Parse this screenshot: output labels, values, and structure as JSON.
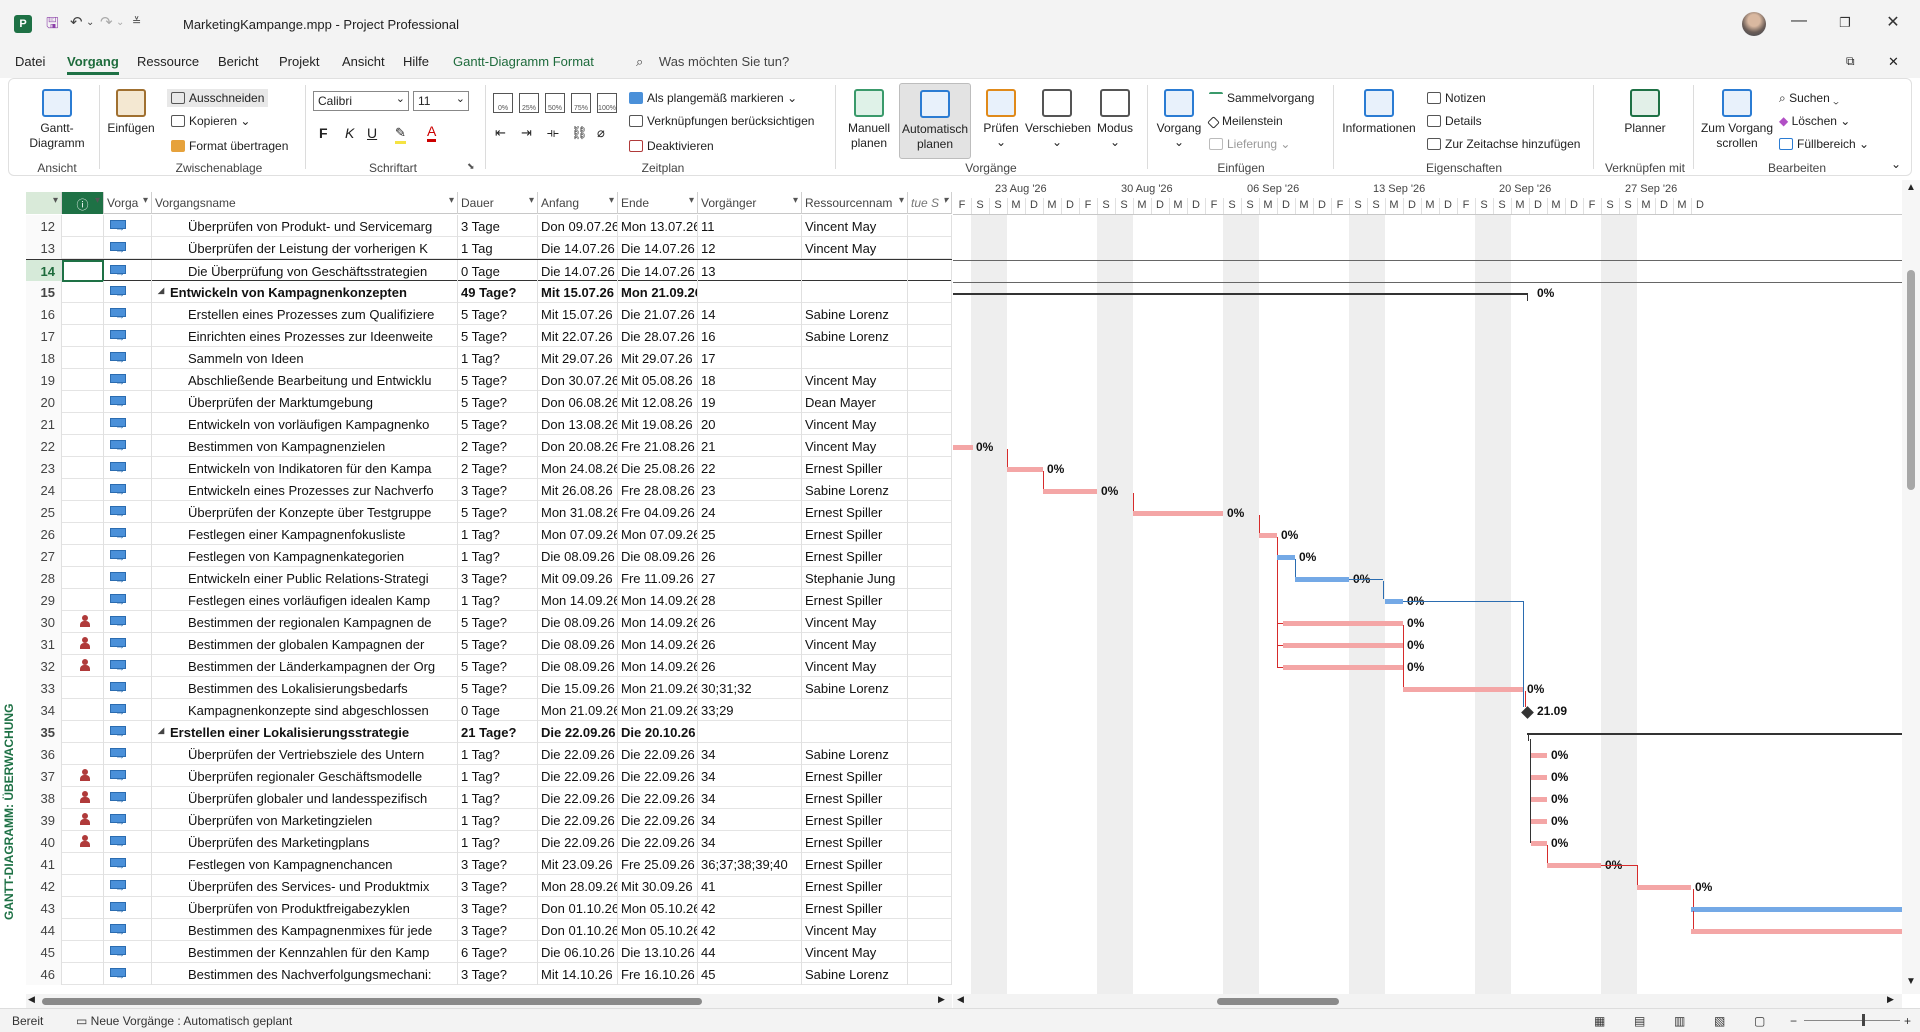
{
  "titlebar": {
    "title": "MarketingKampange.mpp  -  Project Professional",
    "app_icon_letter": "P"
  },
  "menu": {
    "tabs": [
      "Datei",
      "Vorgang",
      "Ressource",
      "Bericht",
      "Projekt",
      "Ansicht",
      "Hilfe",
      "Gantt-Diagramm Format"
    ],
    "active": "Vorgang",
    "search_placeholder": "Was möchten Sie tun?"
  },
  "ribbon": {
    "ansicht": {
      "button": "Gantt-Diagramm",
      "group": "Ansicht"
    },
    "zwischenablage": {
      "paste": "Einfügen",
      "cut": "Ausschneiden",
      "copy": "Kopieren",
      "format_painter": "Format übertragen",
      "group": "Zwischenablage"
    },
    "schriftart": {
      "font": "Calibri",
      "size": "11",
      "bold": "F",
      "italic": "K",
      "underline": "U",
      "group": "Schriftart"
    },
    "zeitplan": {
      "mark_on_track": "Als plangemäß markieren",
      "respect_links": "Verknüpfungen berücksichtigen",
      "deactivate": "Deaktivieren",
      "group": "Zeitplan",
      "pct": [
        "0%",
        "25%",
        "50%",
        "75%",
        "100%"
      ]
    },
    "vorgaenge": {
      "manual": "Manuell planen",
      "auto": "Automatisch planen",
      "inspect": "Prüfen",
      "move": "Verschieben",
      "mode": "Modus",
      "group": "Vorgänge"
    },
    "einfuegen": {
      "task": "Vorgang",
      "summary": "Sammelvorgang",
      "milestone": "Meilenstein",
      "deliverable": "Lieferung",
      "group": "Einfügen"
    },
    "eigenschaften": {
      "info": "Informationen",
      "notes": "Notizen",
      "details": "Details",
      "timeline": "Zur Zeitachse hinzufügen",
      "group": "Eigenschaften"
    },
    "verknuepfen": {
      "planner": "Planner",
      "group": "Verknüpfen mit"
    },
    "bearbeiten": {
      "scroll": "Zum Vorgang scrollen",
      "find": "Suchen",
      "clear": "Löschen",
      "fill": "Füllbereich",
      "group": "Bearbeiten"
    }
  },
  "sidebar": {
    "label": "GANTT-DIAGRAMM: ÜBERWACHUNG"
  },
  "table": {
    "headers": [
      "Vorga",
      "Vorgangsname",
      "Dauer",
      "Anfang",
      "Ende",
      "Vorgänger",
      "Ressourcennam",
      "tue S"
    ],
    "rows": [
      {
        "id": "12",
        "name": "Überprüfen von Produkt- und Servicemarg",
        "dur": "3 Tage",
        "start": "Don 09.07.26",
        "end": "Mon 13.07.26",
        "pred": "11",
        "res": "Vincent May",
        "indent": 2,
        "summary": false,
        "resicon": false
      },
      {
        "id": "13",
        "name": "Überprüfen der Leistung der vorherigen K",
        "dur": "1 Tag",
        "start": "Die 14.07.26",
        "end": "Die 14.07.26",
        "pred": "12",
        "res": "Vincent May",
        "indent": 2,
        "summary": false,
        "resicon": false
      },
      {
        "id": "14",
        "name": "Die Überprüfung von Geschäftsstrategien",
        "dur": "0 Tage",
        "start": "Die 14.07.26",
        "end": "Die 14.07.26",
        "pred": "13",
        "res": "",
        "indent": 2,
        "summary": false,
        "resicon": false,
        "selected": true
      },
      {
        "id": "15",
        "name": "Entwickeln von Kampagnenkonzepten",
        "dur": "49 Tage?",
        "start": "Mit 15.07.26",
        "end": "Mon 21.09.26",
        "pred": "",
        "res": "",
        "indent": 1,
        "summary": true,
        "resicon": false
      },
      {
        "id": "16",
        "name": "Erstellen eines Prozesses zum Qualifiziere",
        "dur": "5 Tage?",
        "start": "Mit 15.07.26",
        "end": "Die 21.07.26",
        "pred": "14",
        "res": "Sabine Lorenz",
        "indent": 2,
        "summary": false,
        "resicon": false
      },
      {
        "id": "17",
        "name": "Einrichten eines Prozesses zur Ideenweite",
        "dur": "5 Tage?",
        "start": "Mit 22.07.26",
        "end": "Die 28.07.26",
        "pred": "16",
        "res": "Sabine Lorenz",
        "indent": 2,
        "summary": false,
        "resicon": false
      },
      {
        "id": "18",
        "name": "Sammeln von Ideen",
        "dur": "1 Tag?",
        "start": "Mit 29.07.26",
        "end": "Mit 29.07.26",
        "pred": "17",
        "res": "",
        "indent": 2,
        "summary": false,
        "resicon": false
      },
      {
        "id": "19",
        "name": "Abschließende Bearbeitung und Entwicklu",
        "dur": "5 Tage?",
        "start": "Don 30.07.26",
        "end": "Mit 05.08.26",
        "pred": "18",
        "res": "Vincent May",
        "indent": 2,
        "summary": false,
        "resicon": false
      },
      {
        "id": "20",
        "name": "Überprüfen der Marktumgebung",
        "dur": "5 Tage?",
        "start": "Don 06.08.26",
        "end": "Mit 12.08.26",
        "pred": "19",
        "res": "Dean Mayer",
        "indent": 2,
        "summary": false,
        "resicon": false
      },
      {
        "id": "21",
        "name": "Entwickeln von vorläufigen Kampagnenko",
        "dur": "5 Tage?",
        "start": "Don 13.08.26",
        "end": "Mit 19.08.26",
        "pred": "20",
        "res": "Vincent May",
        "indent": 2,
        "summary": false,
        "resicon": false
      },
      {
        "id": "22",
        "name": "Bestimmen von Kampagnenzielen",
        "dur": "2 Tage?",
        "start": "Don 20.08.26",
        "end": "Fre 21.08.26",
        "pred": "21",
        "res": "Vincent May",
        "indent": 2,
        "summary": false,
        "resicon": false
      },
      {
        "id": "23",
        "name": "Entwickeln von Indikatoren für den Kampa",
        "dur": "2 Tage?",
        "start": "Mon 24.08.26",
        "end": "Die 25.08.26",
        "pred": "22",
        "res": "Ernest Spiller",
        "indent": 2,
        "summary": false,
        "resicon": false
      },
      {
        "id": "24",
        "name": "Entwickeln eines Prozesses zur Nachverfo",
        "dur": "3 Tage?",
        "start": "Mit 26.08.26",
        "end": "Fre 28.08.26",
        "pred": "23",
        "res": "Sabine Lorenz",
        "indent": 2,
        "summary": false,
        "resicon": false
      },
      {
        "id": "25",
        "name": "Überprüfen der Konzepte über Testgruppe",
        "dur": "5 Tage?",
        "start": "Mon 31.08.26",
        "end": "Fre 04.09.26",
        "pred": "24",
        "res": "Ernest Spiller",
        "indent": 2,
        "summary": false,
        "resicon": false
      },
      {
        "id": "26",
        "name": "Festlegen einer Kampagnenfokusliste",
        "dur": "1 Tag?",
        "start": "Mon 07.09.26",
        "end": "Mon 07.09.26",
        "pred": "25",
        "res": "Ernest Spiller",
        "indent": 2,
        "summary": false,
        "resicon": false
      },
      {
        "id": "27",
        "name": "Festlegen von Kampagnenkategorien",
        "dur": "1 Tag?",
        "start": "Die 08.09.26",
        "end": "Die 08.09.26",
        "pred": "26",
        "res": "Ernest Spiller",
        "indent": 2,
        "summary": false,
        "resicon": false
      },
      {
        "id": "28",
        "name": "Entwickeln einer Public Relations-Strategi",
        "dur": "3 Tage?",
        "start": "Mit 09.09.26",
        "end": "Fre 11.09.26",
        "pred": "27",
        "res": "Stephanie Jung",
        "indent": 2,
        "summary": false,
        "resicon": false
      },
      {
        "id": "29",
        "name": "Festlegen eines vorläufigen idealen Kamp",
        "dur": "1 Tag?",
        "start": "Mon 14.09.26",
        "end": "Mon 14.09.26",
        "pred": "28",
        "res": "Ernest Spiller",
        "indent": 2,
        "summary": false,
        "resicon": false
      },
      {
        "id": "30",
        "name": "Bestimmen der regionalen Kampagnen de",
        "dur": "5 Tage?",
        "start": "Die 08.09.26",
        "end": "Mon 14.09.26",
        "pred": "26",
        "res": "Vincent May",
        "indent": 2,
        "summary": false,
        "resicon": true
      },
      {
        "id": "31",
        "name": "Bestimmen der globalen Kampagnen der",
        "dur": "5 Tage?",
        "start": "Die 08.09.26",
        "end": "Mon 14.09.26",
        "pred": "26",
        "res": "Vincent May",
        "indent": 2,
        "summary": false,
        "resicon": true
      },
      {
        "id": "32",
        "name": "Bestimmen der Länderkampagnen der Org",
        "dur": "5 Tage?",
        "start": "Die 08.09.26",
        "end": "Mon 14.09.26",
        "pred": "26",
        "res": "Vincent May",
        "indent": 2,
        "summary": false,
        "resicon": true
      },
      {
        "id": "33",
        "name": "Bestimmen des Lokalisierungsbedarfs",
        "dur": "5 Tage?",
        "start": "Die 15.09.26",
        "end": "Mon 21.09.26",
        "pred": "30;31;32",
        "res": "Sabine Lorenz",
        "indent": 2,
        "summary": false,
        "resicon": false
      },
      {
        "id": "34",
        "name": "Kampagnenkonzepte sind abgeschlossen",
        "dur": "0 Tage",
        "start": "Mon 21.09.26",
        "end": "Mon 21.09.26",
        "pred": "33;29",
        "res": "",
        "indent": 2,
        "summary": false,
        "resicon": false
      },
      {
        "id": "35",
        "name": "Erstellen einer Lokalisierungsstrategie",
        "dur": "21 Tage?",
        "start": "Die 22.09.26",
        "end": "Die 20.10.26",
        "pred": "",
        "res": "",
        "indent": 1,
        "summary": true,
        "resicon": false
      },
      {
        "id": "36",
        "name": "Überprüfen der Vertriebsziele des Untern",
        "dur": "1 Tag?",
        "start": "Die 22.09.26",
        "end": "Die 22.09.26",
        "pred": "34",
        "res": "Sabine Lorenz",
        "indent": 2,
        "summary": false,
        "resicon": false
      },
      {
        "id": "37",
        "name": "Überprüfen regionaler Geschäftsmodelle",
        "dur": "1 Tag?",
        "start": "Die 22.09.26",
        "end": "Die 22.09.26",
        "pred": "34",
        "res": "Ernest Spiller",
        "indent": 2,
        "summary": false,
        "resicon": true
      },
      {
        "id": "38",
        "name": "Überprüfen globaler und landesspezifisch",
        "dur": "1 Tag?",
        "start": "Die 22.09.26",
        "end": "Die 22.09.26",
        "pred": "34",
        "res": "Ernest Spiller",
        "indent": 2,
        "summary": false,
        "resicon": true
      },
      {
        "id": "39",
        "name": "Überprüfen von Marketingzielen",
        "dur": "1 Tag?",
        "start": "Die 22.09.26",
        "end": "Die 22.09.26",
        "pred": "34",
        "res": "Ernest Spiller",
        "indent": 2,
        "summary": false,
        "resicon": true
      },
      {
        "id": "40",
        "name": "Überprüfen des Marketingplans",
        "dur": "1 Tag?",
        "start": "Die 22.09.26",
        "end": "Die 22.09.26",
        "pred": "34",
        "res": "Ernest Spiller",
        "indent": 2,
        "summary": false,
        "resicon": true
      },
      {
        "id": "41",
        "name": "Festlegen von Kampagnenchancen",
        "dur": "3 Tage?",
        "start": "Mit 23.09.26",
        "end": "Fre 25.09.26",
        "pred": "36;37;38;39;40",
        "res": "Ernest Spiller",
        "indent": 2,
        "summary": false,
        "resicon": false
      },
      {
        "id": "42",
        "name": "Überprüfen des Services- und Produktmix",
        "dur": "3 Tage?",
        "start": "Mon 28.09.26",
        "end": "Mit 30.09.26",
        "pred": "41",
        "res": "Ernest Spiller",
        "indent": 2,
        "summary": false,
        "resicon": false
      },
      {
        "id": "43",
        "name": "Überprüfen von Produktfreigabezyklen",
        "dur": "3 Tage?",
        "start": "Don 01.10.26",
        "end": "Mon 05.10.26",
        "pred": "42",
        "res": "Ernest Spiller",
        "indent": 2,
        "summary": false,
        "resicon": false
      },
      {
        "id": "44",
        "name": "Bestimmen des Kampagnenmixes für jede",
        "dur": "3 Tage?",
        "start": "Don 01.10.26",
        "end": "Mon 05.10.26",
        "pred": "42",
        "res": "Vincent May",
        "indent": 2,
        "summary": false,
        "resicon": false
      },
      {
        "id": "45",
        "name": "Bestimmen der Kennzahlen für den Kamp",
        "dur": "6 Tage?",
        "start": "Die 06.10.26",
        "end": "Die 13.10.26",
        "pred": "44",
        "res": "Vincent May",
        "indent": 2,
        "summary": false,
        "resicon": false
      },
      {
        "id": "46",
        "name": "Bestimmen des Nachverfolgungsmechani:",
        "dur": "3 Tage?",
        "start": "Mit 14.10.26",
        "end": "Fre 16.10.26",
        "pred": "45",
        "res": "Sabine Lorenz",
        "indent": 2,
        "summary": false,
        "resicon": false
      }
    ]
  },
  "gantt": {
    "weeks": [
      "23 Aug '26",
      "30 Aug '26",
      "06 Sep '26",
      "13 Sep '26",
      "20 Sep '26",
      "27 Sep '26"
    ],
    "day_letters": [
      "F",
      "S",
      "S",
      "M",
      "D",
      "M",
      "D",
      "F",
      "S",
      "S",
      "M",
      "D",
      "M",
      "D",
      "F",
      "S",
      "S",
      "M",
      "D",
      "M",
      "D",
      "F",
      "S",
      "S",
      "M",
      "D",
      "M",
      "D",
      "F",
      "S",
      "S",
      "M",
      "D",
      "M",
      "D",
      "F",
      "S",
      "S",
      "M",
      "D",
      "M",
      "D"
    ],
    "labels": {
      "r15": "0%",
      "r22": "0%",
      "r23": "0%",
      "r24": "0%",
      "r25": "0%",
      "r26": "0%",
      "r27": "0%",
      "r28": "0%",
      "r29": "0%",
      "r30": "0%",
      "r31": "0%",
      "r32": "0%",
      "r33": "0%",
      "r34": "21.09",
      "r36": "0%",
      "r37": "0%",
      "r38": "0%",
      "r39": "0%",
      "r40": "0%",
      "r41": "0%",
      "r42": "0%"
    },
    "colors": {
      "critical": "#f4a6a6",
      "normal": "#74a9e6",
      "link_red": "#d62b2b",
      "link_blue": "#2b6cb0"
    }
  },
  "status": {
    "ready": "Bereit",
    "new_tasks": "Neue Vorgänge : Automatisch geplant"
  }
}
